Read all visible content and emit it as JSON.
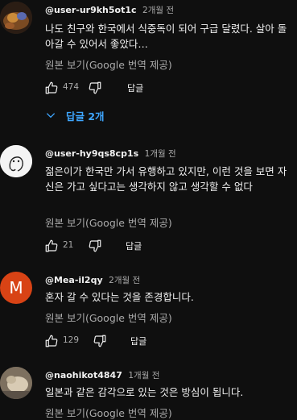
{
  "comments": [
    {
      "author": "@user-ur9kh5ot1c",
      "time": "2개월 전",
      "text": "나도 친구와 한국에서 식중독이 되어 구급 달렸다. 살아 돌아갈 수 있어서 좋았다…",
      "translate": "원본 보기(Google 번역 제공)",
      "likes": "474",
      "reply": "답글",
      "replies_toggle": "답글 2개"
    },
    {
      "author": "@user-hy9qs8cp1s",
      "time": "1개월 전",
      "text": "젊은이가 한국만 가서 유행하고 있지만, 이런 것을 보면 자신은 가고 싶다고는 생각하지 않고 생각할 수 없다",
      "translate": "원본 보기(Google 번역 제공)",
      "likes": "21",
      "reply": "답글"
    },
    {
      "author": "@Mea-il2qy",
      "time": "2개월 전",
      "avatar_letter": "M",
      "text": "혼자 갈 수 있다는 것을 존경합니다.",
      "translate": "원본 보기(Google 번역 제공)",
      "likes": "129",
      "reply": "답글"
    },
    {
      "author": "@naohikot4847",
      "time": "1개월 전",
      "text": "일본과 같은 감각으로 있는 것은 방심이 됩니다.",
      "translate": "원본 보기(Google 번역 제공)"
    }
  ],
  "colors": {
    "background": "#0f0f0f",
    "link": "#3ea6ff",
    "secondary_text": "#aaaaaa",
    "avatar_m": "#d84315"
  }
}
